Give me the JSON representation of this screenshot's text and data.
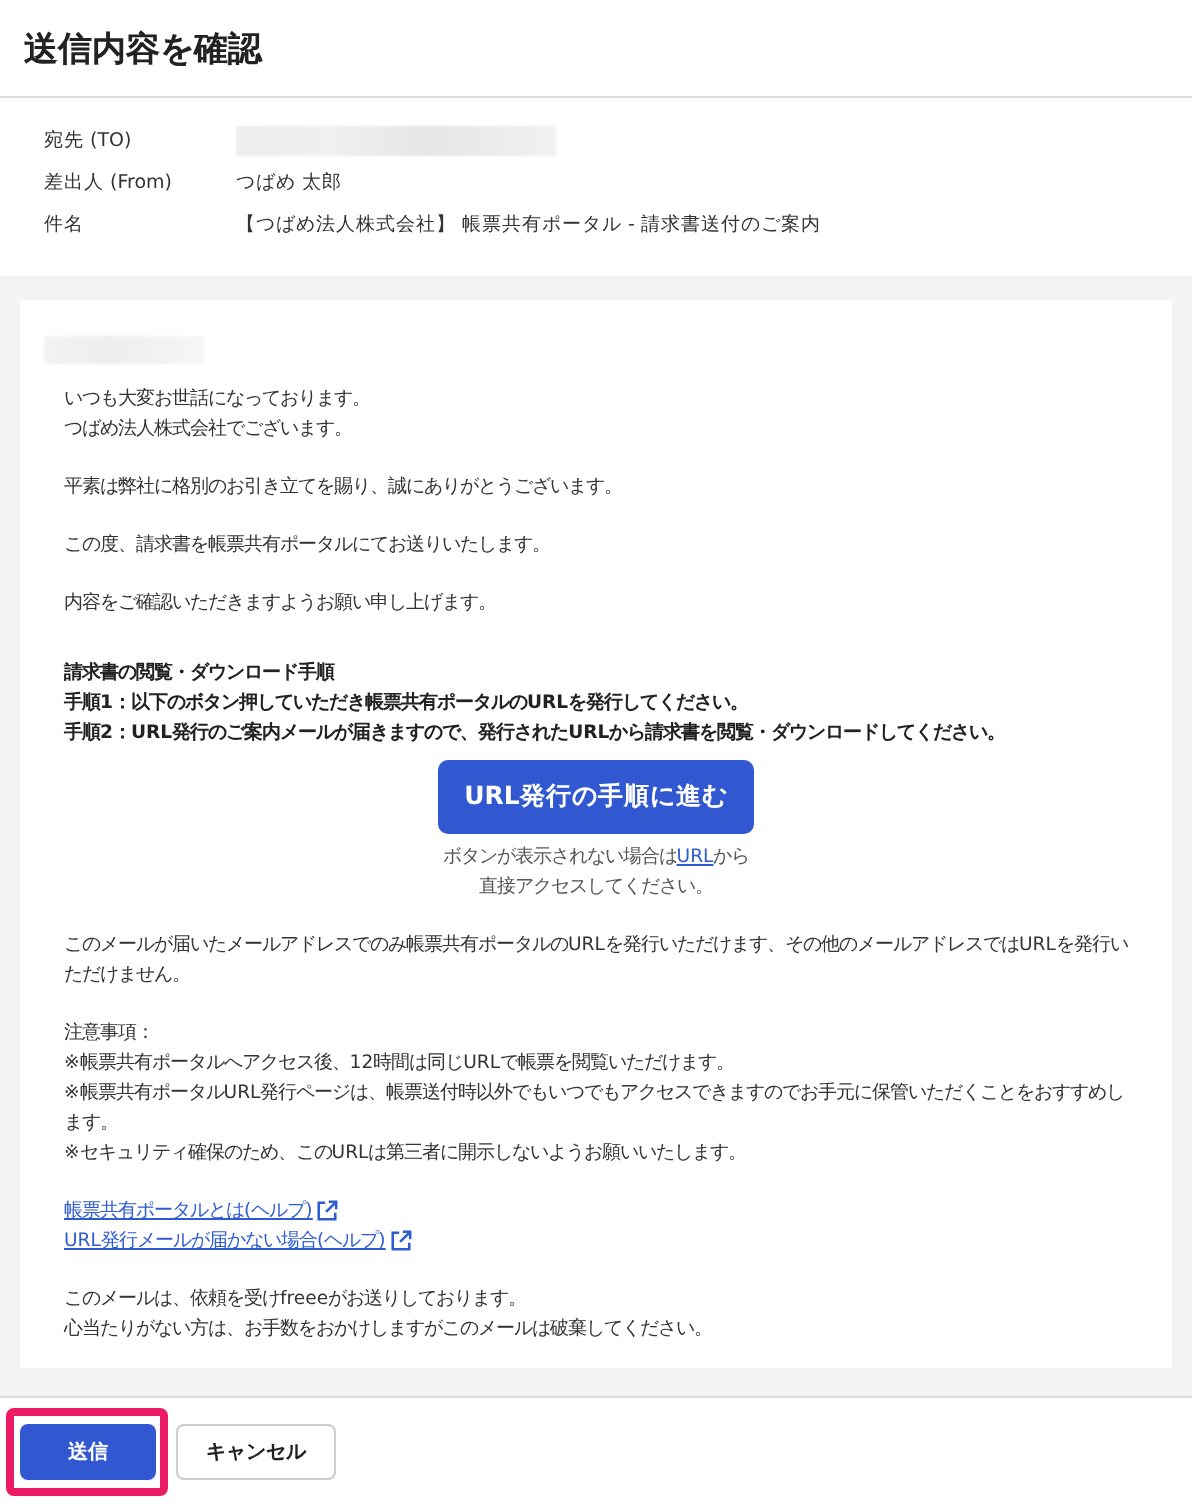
{
  "header": {
    "title": "送信内容を確認"
  },
  "meta": [
    {
      "label": "宛先 (TO)",
      "kind": "redacted"
    },
    {
      "label": "差出人 (From)",
      "kind": "text",
      "value": "つばめ 太郎"
    },
    {
      "label": "件名",
      "kind": "text",
      "value": "【つばめ法人株式会社】 帳票共有ポータル - 請求書送付のご案内"
    }
  ],
  "body": {
    "greeting_redacted": true,
    "blocks": [
      {
        "kind": "paragraph",
        "lines": [
          "いつも大変お世話になっております。",
          "つばめ法人株式会社でございます。"
        ]
      },
      {
        "kind": "paragraph",
        "lines": [
          "平素は弊社に格別のお引き立てを賜り、誠にありがとうございます。"
        ]
      },
      {
        "kind": "paragraph",
        "lines": [
          "この度、請求書を帳票共有ポータルにてお送りいたします。"
        ]
      },
      {
        "kind": "paragraph",
        "lines": [
          "内容をご確認いただきますようお願い申し上げます。"
        ]
      },
      {
        "kind": "steps",
        "lines": [
          "請求書の閲覧・ダウンロード手順",
          "手順1：以下のボタン押していただき帳票共有ポータルのURLを発行してください。",
          "手順2：URL発行のご案内メールが届きますので、発行されたURLから請求書を閲覧・ダウンロードしてください。"
        ]
      },
      {
        "kind": "button",
        "label": "URL発行の手順に進む"
      },
      {
        "kind": "note",
        "before": "ボタンが表示されない場合は",
        "link": "URL",
        "after": "から",
        "line2": "直接アクセスしてください。"
      },
      {
        "kind": "paragraph",
        "lines": [
          "このメールが届いたメールアドレスでのみ帳票共有ポータルのURLを発行いただけます、その他のメールアドレスではURLを発行いただけません。"
        ]
      },
      {
        "kind": "paragraph",
        "lines": [
          "注意事項：",
          "※帳票共有ポータルへアクセス後、12時間は同じURLで帳票を閲覧いただけます。",
          "※帳票共有ポータルURL発行ページは、帳票送付時以外でもいつでもアクセスできますのでお手元に保管いただくことをおすすめします。",
          "※セキュリティ確保のため、このURLは第三者に開示しないようお願いいたします。"
        ]
      },
      {
        "kind": "links",
        "links": [
          "帳票共有ポータルとは(ヘルプ)",
          "URL発行メールが届かない場合(ヘルプ)"
        ]
      },
      {
        "kind": "paragraph",
        "lines": [
          "このメールは、依頼を受けfreeeがお送りしております。",
          "心当たりがない方は、お手数をおかけしますがこのメールは破棄してください。"
        ]
      }
    ]
  },
  "footer": {
    "buttons": [
      {
        "label": "送信",
        "kind": "primary",
        "highlighted": true
      },
      {
        "label": "キャンセル",
        "kind": "secondary",
        "highlighted": false
      }
    ]
  }
}
